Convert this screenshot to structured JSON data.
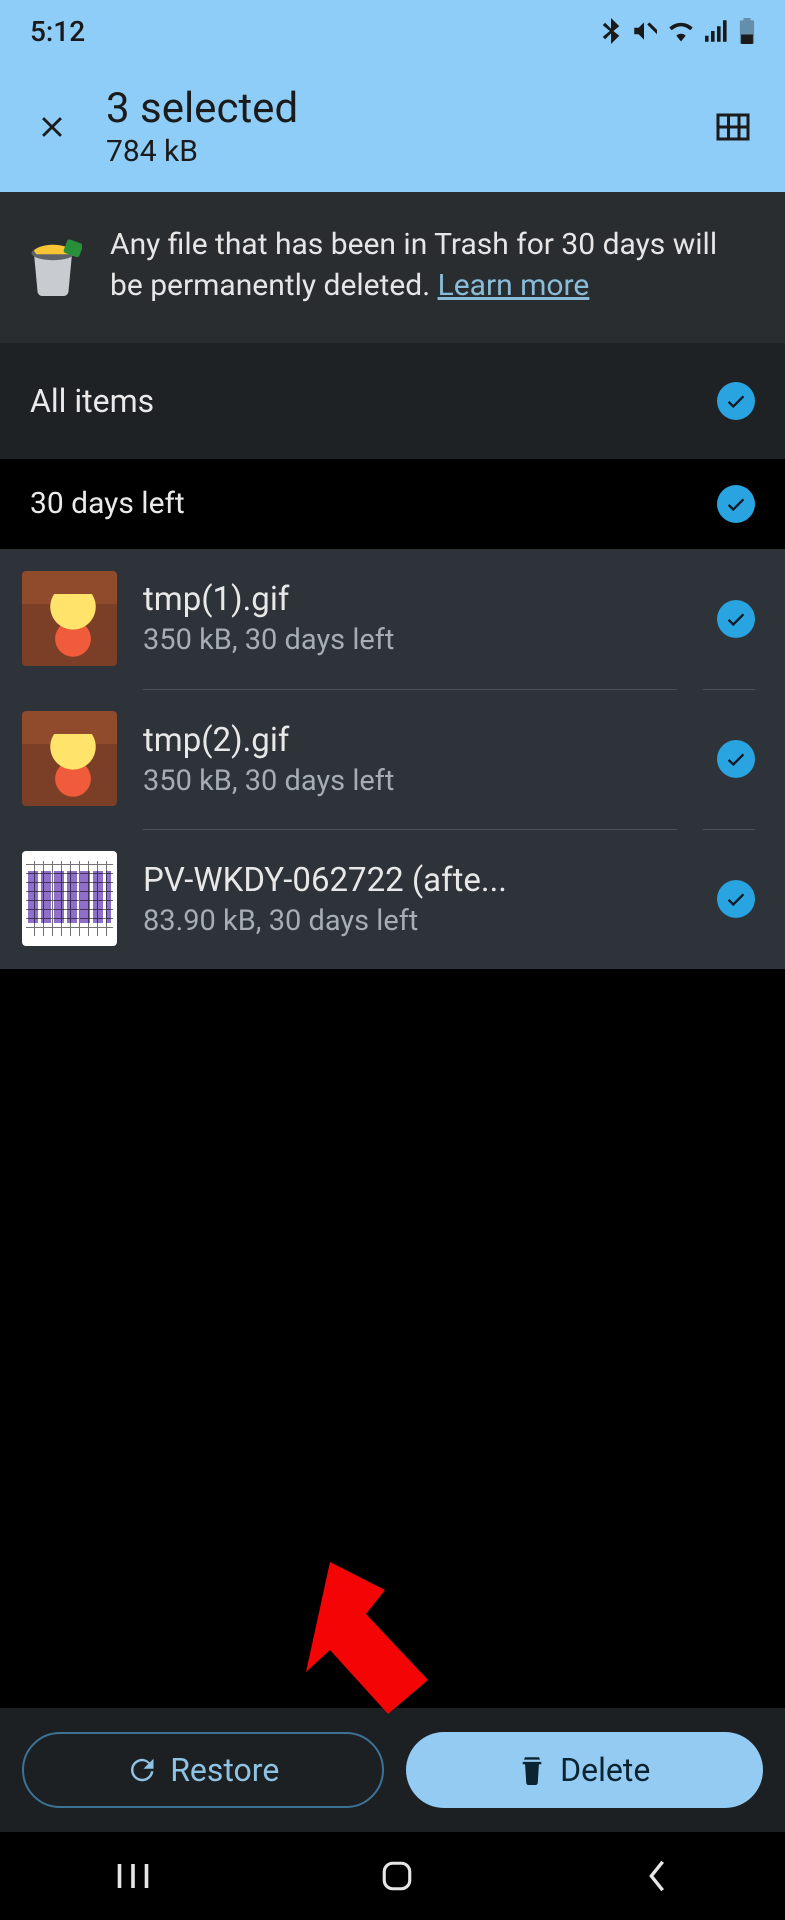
{
  "status": {
    "time": "5:12"
  },
  "header": {
    "title": "3 selected",
    "subtitle": "784 kB"
  },
  "banner": {
    "text": "Any file that has been in Trash for 30 days will be permanently deleted. ",
    "link": "Learn more"
  },
  "sections": {
    "all_items": "All items",
    "days_left": "30 days left"
  },
  "files": [
    {
      "name": "tmp(1).gif",
      "meta": "350 kB, 30 days left",
      "thumb": "lisa"
    },
    {
      "name": "tmp(2).gif",
      "meta": "350 kB, 30 days left",
      "thumb": "lisa"
    },
    {
      "name": "PV-WKDY-062722 (afte...",
      "meta": "83.90 kB, 30 days left",
      "thumb": "doc"
    }
  ],
  "buttons": {
    "restore": "Restore",
    "delete": "Delete"
  }
}
